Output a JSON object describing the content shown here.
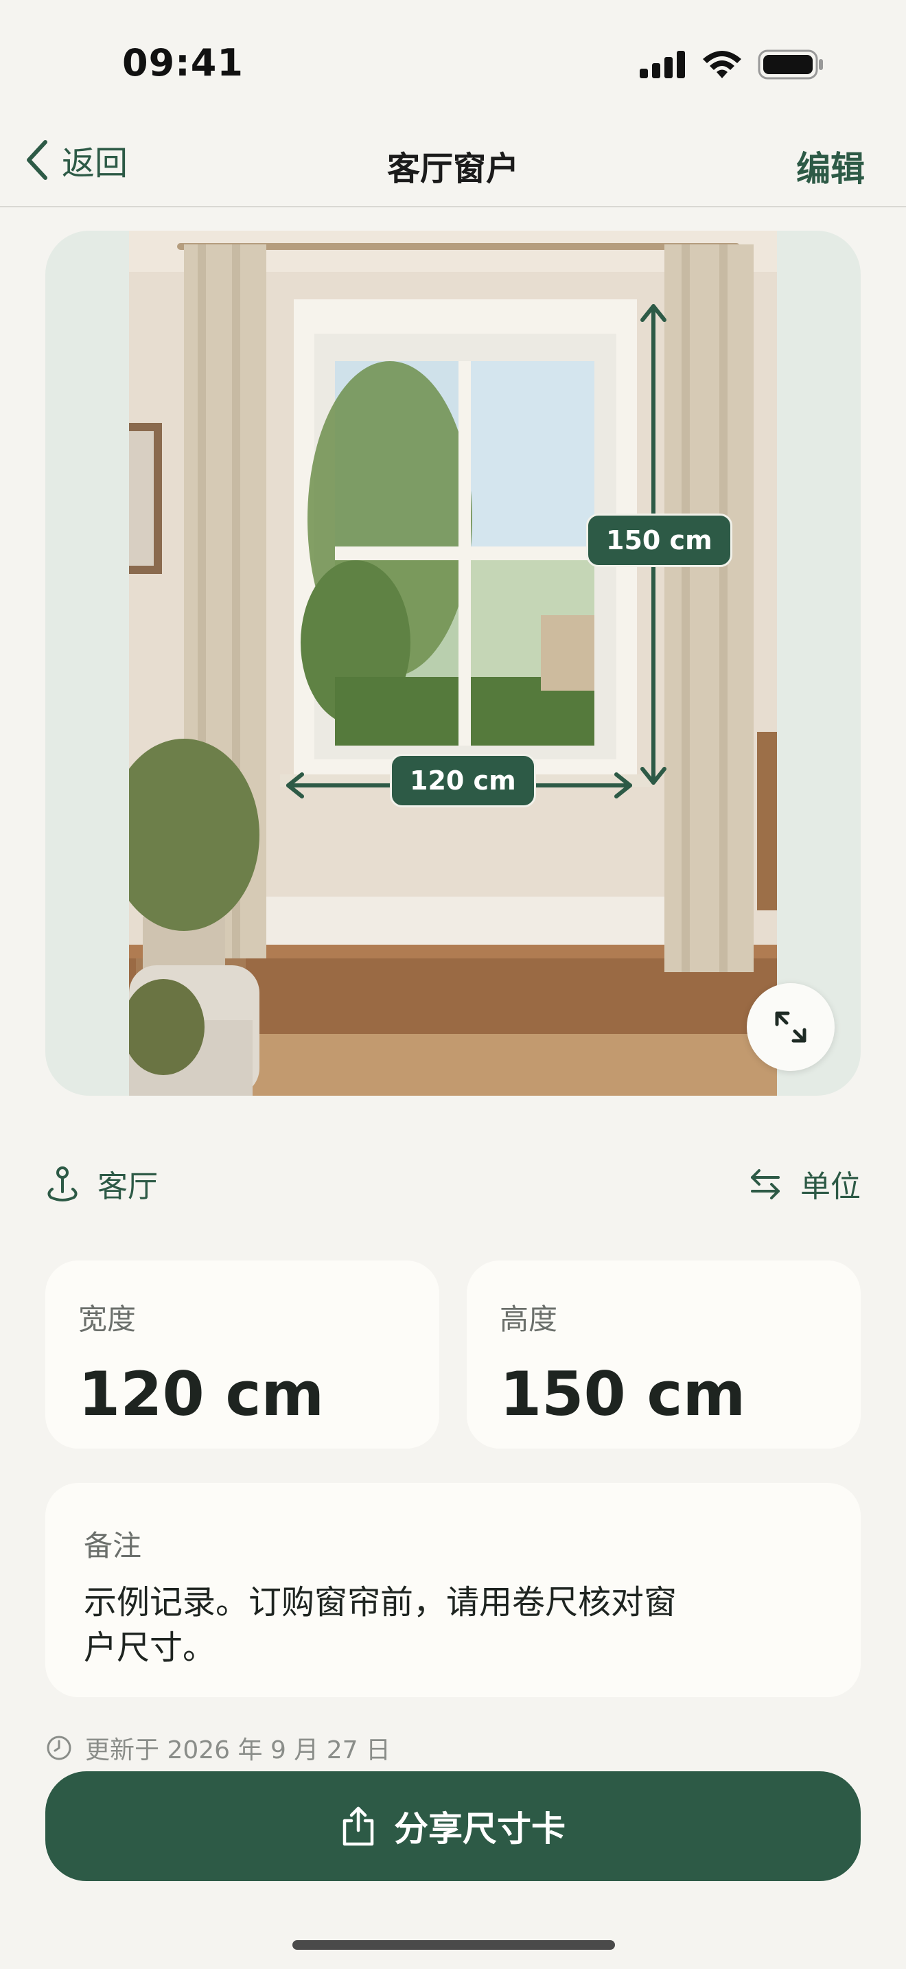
{
  "status_bar": {
    "time": "09:41",
    "icons": [
      "signal-icon",
      "wifi-icon",
      "battery-icon"
    ]
  },
  "nav": {
    "back_label": "返回",
    "title": "客厅窗户",
    "edit_label": "编辑"
  },
  "photo": {
    "width_label": "120 cm",
    "height_label": "150 cm",
    "expand_icon": "expand-icon"
  },
  "meta": {
    "room_label": "客厅",
    "unit_label": "单位"
  },
  "width_card": {
    "label": "宽度",
    "value": "120 cm"
  },
  "height_card": {
    "label": "高度",
    "value": "150 cm"
  },
  "notes": {
    "label": "备注",
    "text": "示例记录。订购窗帘前，请用卷尺核对窗户尺寸。"
  },
  "updated_text": "更新于 2026 年 9 月 27 日",
  "share_button": {
    "label": "分享尺寸卡"
  },
  "colors": {
    "accent": "#2d5a46",
    "background": "#f5f4f0",
    "card": "#fdfcf8"
  }
}
